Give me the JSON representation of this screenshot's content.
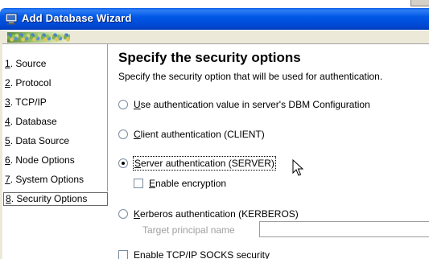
{
  "window": {
    "title": "Add Database Wizard"
  },
  "sidebar": {
    "items": [
      {
        "mnemonic": "1",
        "label": ". Source"
      },
      {
        "mnemonic": "2",
        "label": ". Protocol"
      },
      {
        "mnemonic": "3",
        "label": ". TCP/IP"
      },
      {
        "mnemonic": "4",
        "label": ". Database"
      },
      {
        "mnemonic": "5",
        "label": ". Data Source"
      },
      {
        "mnemonic": "6",
        "label": ". Node Options"
      },
      {
        "mnemonic": "7",
        "label": ". System Options"
      },
      {
        "mnemonic": "8",
        "label": ". Security Options"
      }
    ],
    "selected_index": 7
  },
  "main": {
    "heading": "Specify the security options",
    "subheading": "Specify the security option that will be used for authentication.",
    "options": [
      {
        "mnemonic": "U",
        "rest": "se authentication value in server's DBM Configuration",
        "selected": false
      },
      {
        "mnemonic": "C",
        "rest": "lient authentication (CLIENT)",
        "selected": false
      },
      {
        "mnemonic": "S",
        "rest": "erver authentication (SERVER)",
        "selected": true
      },
      {
        "mnemonic": "K",
        "rest": "erberos authentication (KERBEROS)",
        "selected": false
      }
    ],
    "encryption": {
      "mnemonic": "E",
      "rest": "nable encryption",
      "checked": false
    },
    "target_principal": {
      "label": "Target principal name",
      "value": ""
    },
    "socks": {
      "label": "Enable TCP/IP SOCKS security",
      "checked": false
    }
  }
}
